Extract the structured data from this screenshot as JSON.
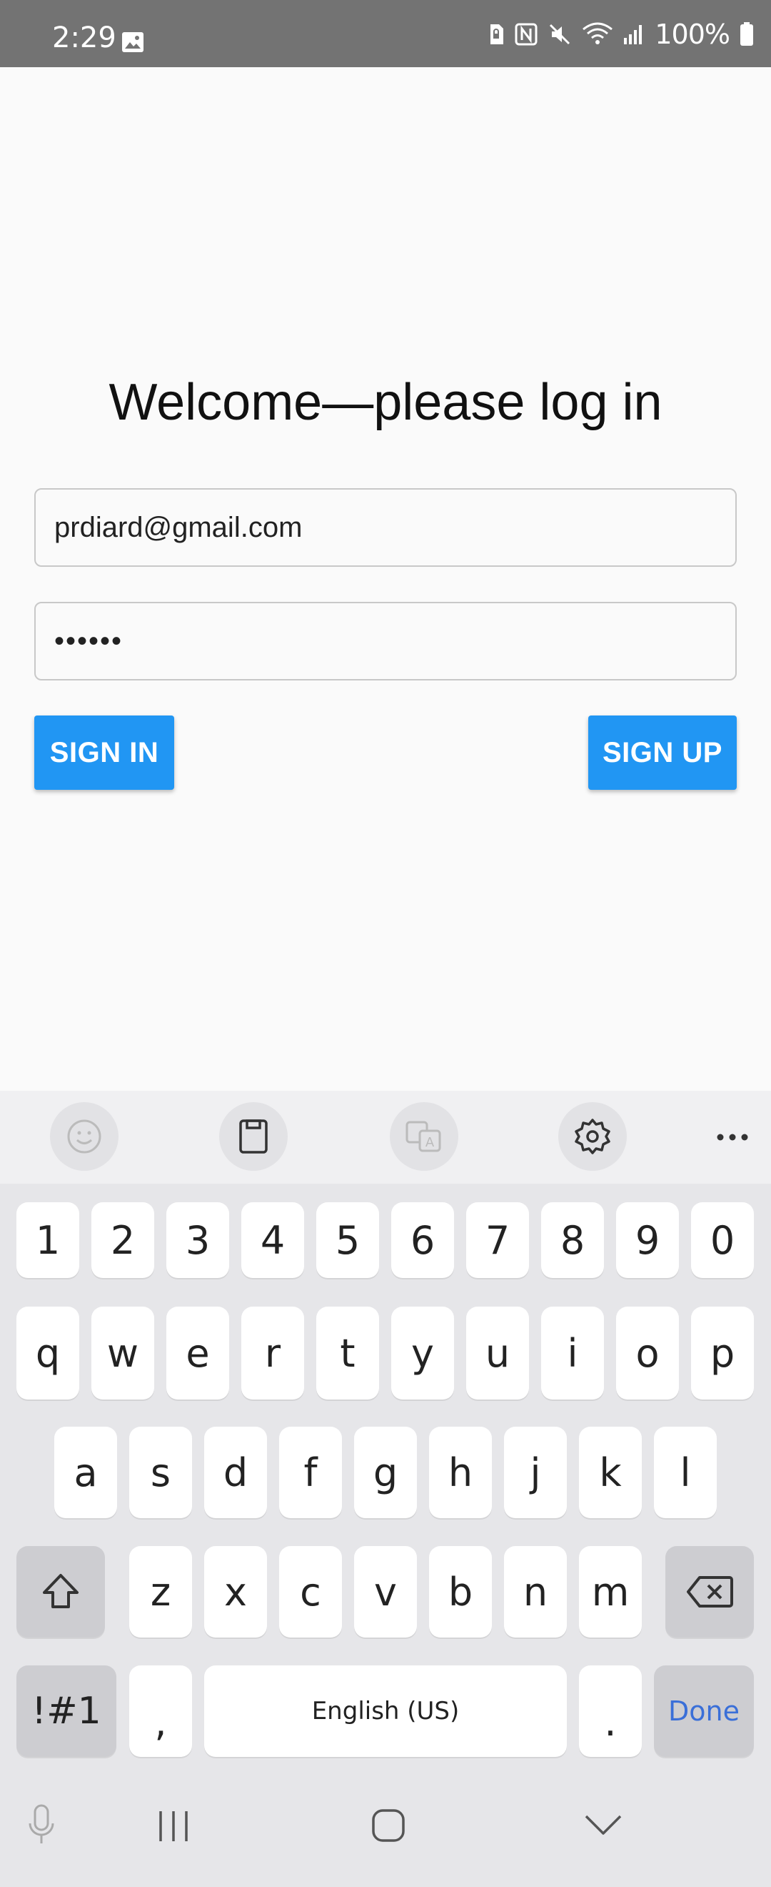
{
  "status_bar": {
    "time": "2:29",
    "battery_text": "100%",
    "icons": [
      "gallery-icon",
      "sim-lock-icon",
      "nfc-icon",
      "mute-icon",
      "wifi-icon",
      "signal-icon",
      "battery-icon"
    ]
  },
  "login": {
    "title": "Welcome—please log in",
    "email_value": "prdiard@gmail.com",
    "password_value": "••••••",
    "sign_in_label": "SIGN IN",
    "sign_up_label": "SIGN UP",
    "accent_color": "#2196f3"
  },
  "keyboard_toolbar": {
    "icons": [
      "emoji-icon",
      "clipboard-icon",
      "translate-icon",
      "settings-icon",
      "more-icon"
    ]
  },
  "keyboard": {
    "number_row": [
      "1",
      "2",
      "3",
      "4",
      "5",
      "6",
      "7",
      "8",
      "9",
      "0"
    ],
    "row1": [
      "q",
      "w",
      "e",
      "r",
      "t",
      "y",
      "u",
      "i",
      "o",
      "p"
    ],
    "row2": [
      "a",
      "s",
      "d",
      "f",
      "g",
      "h",
      "j",
      "k",
      "l"
    ],
    "row3": [
      "z",
      "x",
      "c",
      "v",
      "b",
      "n",
      "m"
    ],
    "symbols_label": "!#1",
    "comma_label": ",",
    "space_label": "English (US)",
    "period_label": ".",
    "done_label": "Done",
    "done_color": "#3a6fd8"
  },
  "nav_bar": {
    "icons": [
      "mic-icon",
      "recents-icon",
      "home-icon",
      "hide-keyboard-icon"
    ]
  }
}
